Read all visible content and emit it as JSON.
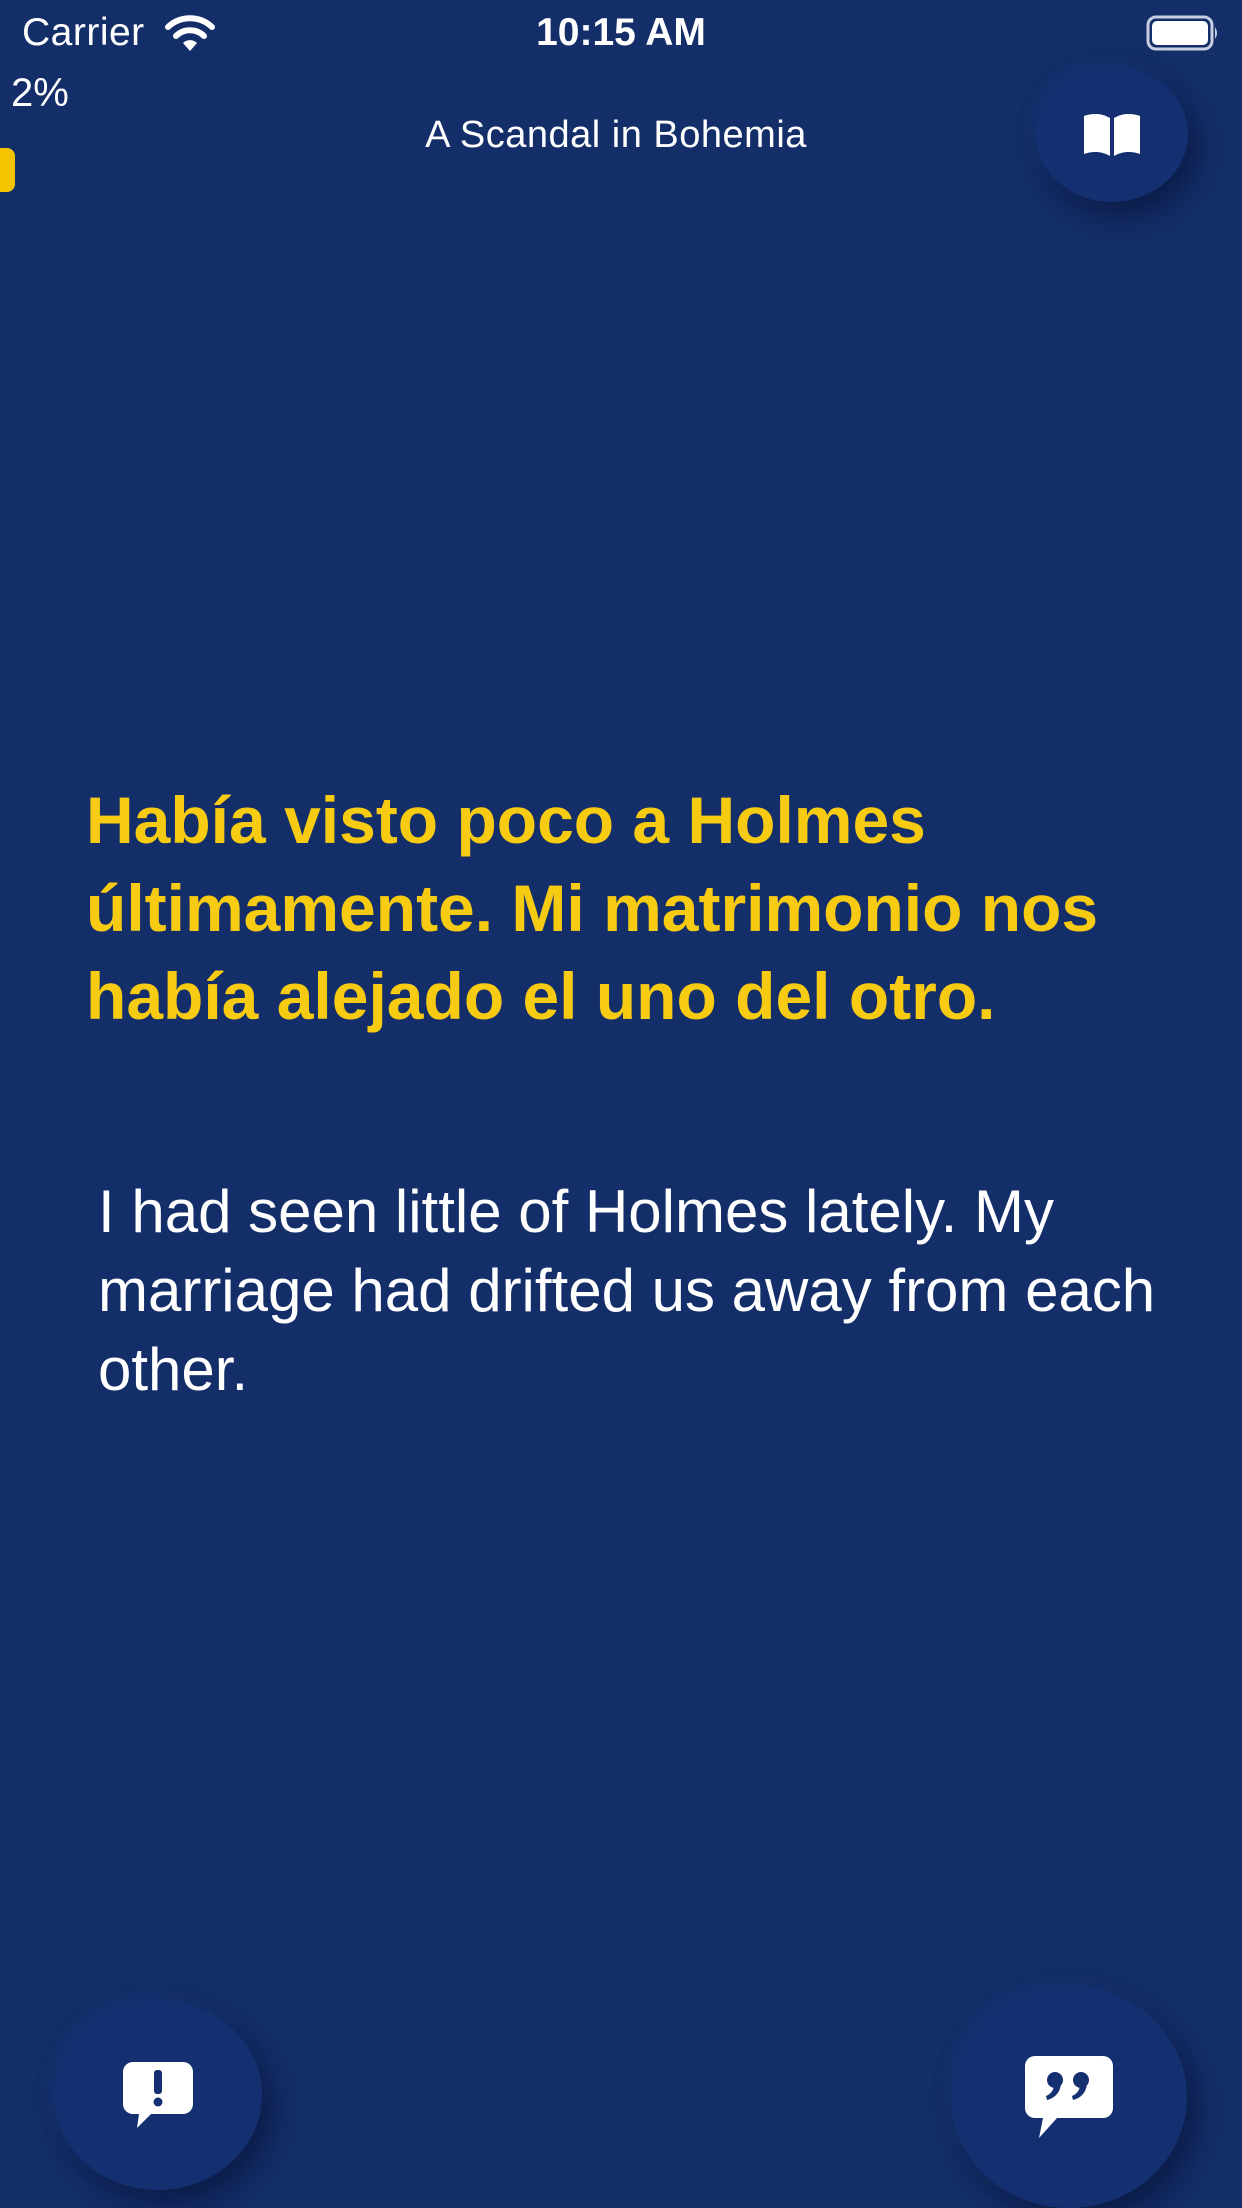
{
  "status_bar": {
    "carrier": "Carrier",
    "time": "10:15 AM"
  },
  "reader": {
    "progress_text": "2%",
    "progress_fraction": 0.02,
    "book_title": "A Scandal in Bohemia",
    "original_sentence": "Había visto poco a Holmes últimamente. Mi matrimonio nos había alejado el uno del otro.",
    "translated_sentence": "I had seen little of Holmes lately. My marriage had drifted us away from each other."
  },
  "icons": {
    "wifi": "wifi-icon",
    "battery": "battery-icon",
    "book": "open-book-icon",
    "report": "exclamation-bubble-icon",
    "quote": "quote-bubble-icon"
  },
  "colors": {
    "background": "#142e69",
    "accent": "#f7cb12",
    "text": "#ffffff"
  }
}
